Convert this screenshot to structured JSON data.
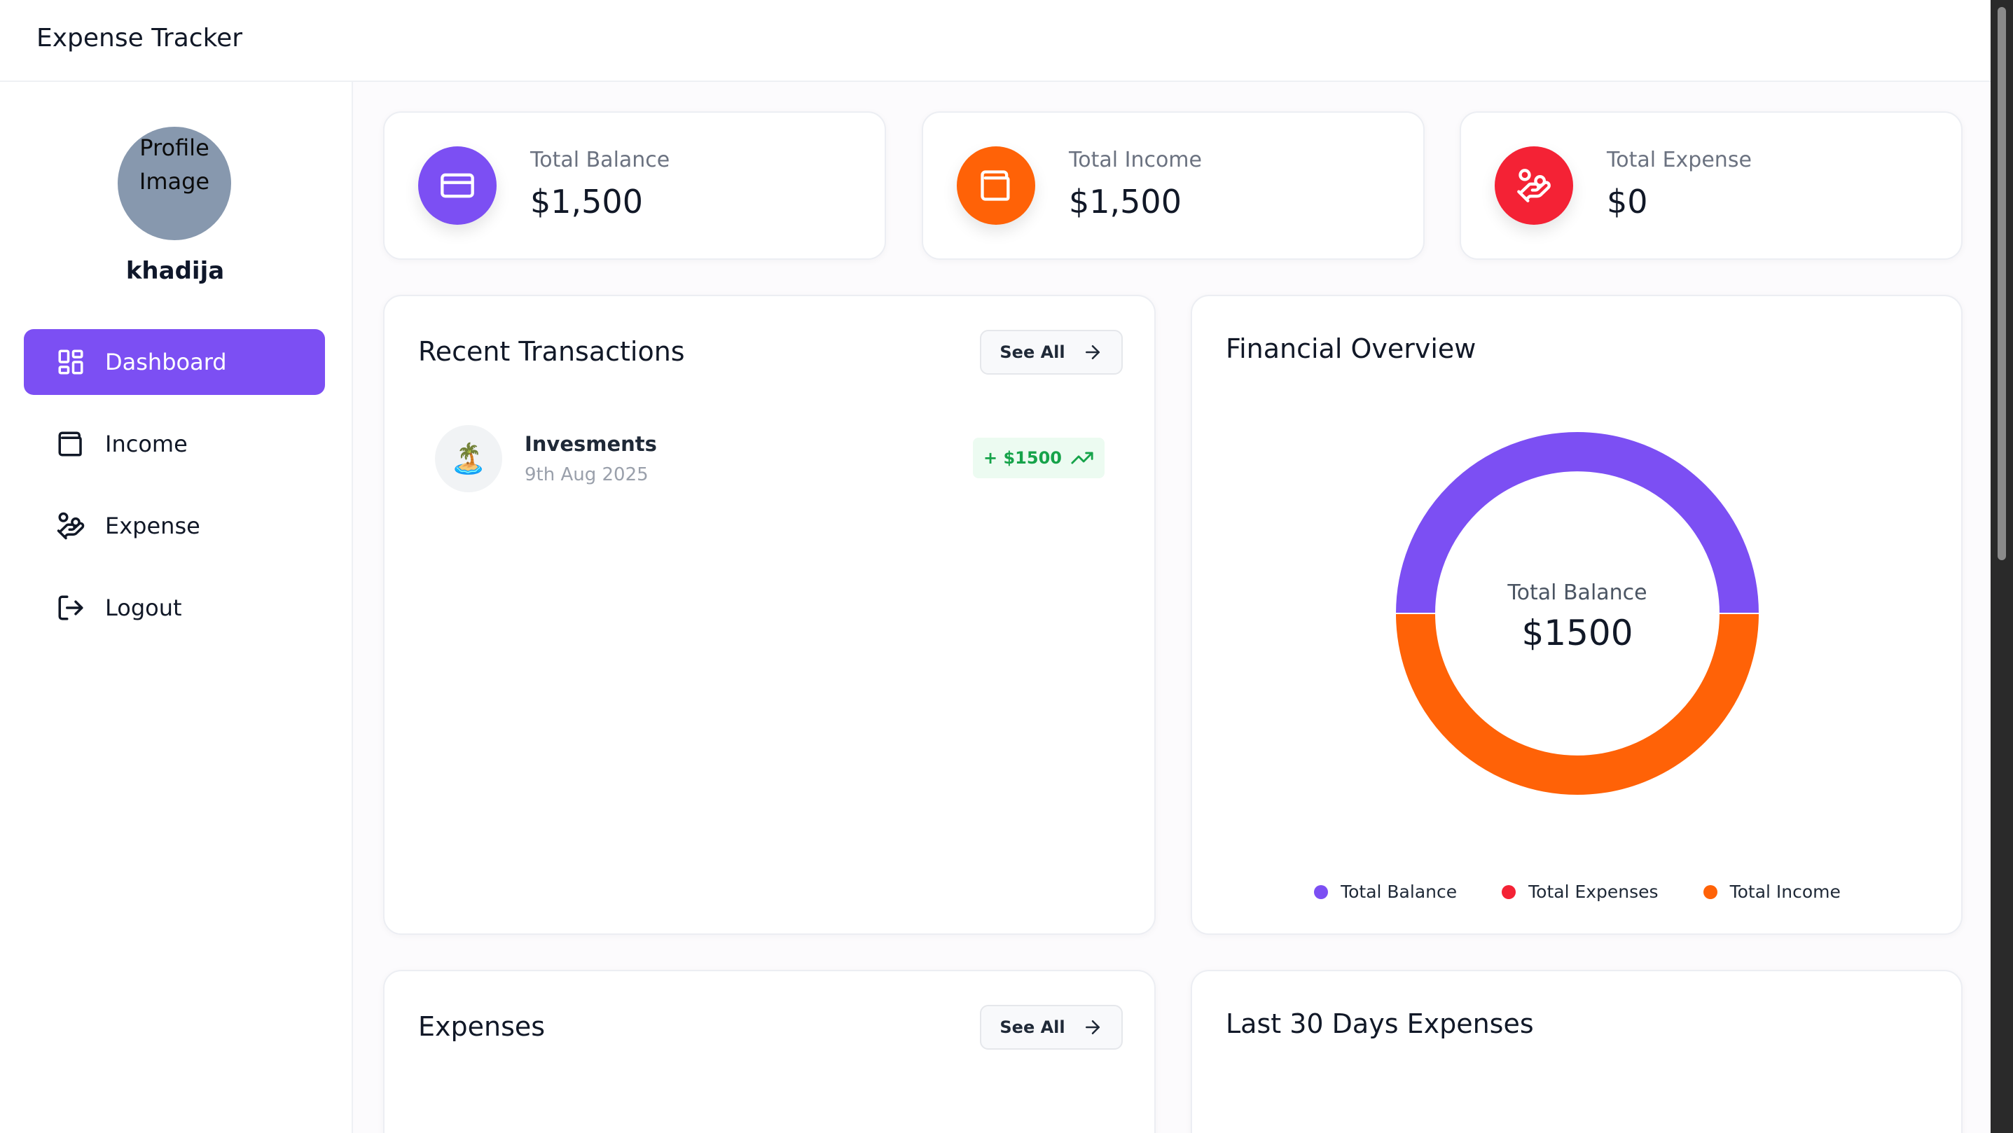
{
  "app": {
    "title": "Expense Tracker"
  },
  "profile": {
    "image_alt": "Profile Image",
    "name": "khadija"
  },
  "nav": [
    {
      "label": "Dashboard",
      "icon": "dashboard-icon",
      "active": true
    },
    {
      "label": "Income",
      "icon": "wallet-icon",
      "active": false
    },
    {
      "label": "Expense",
      "icon": "hand-coins-icon",
      "active": false
    },
    {
      "label": "Logout",
      "icon": "logout-icon",
      "active": false
    }
  ],
  "stats": [
    {
      "label": "Total Balance",
      "value": "$1,500",
      "icon": "credit-card-icon",
      "color": "#7c4ff3"
    },
    {
      "label": "Total Income",
      "value": "$1,500",
      "icon": "wallet-icon",
      "color": "#ff6207"
    },
    {
      "label": "Total Expense",
      "value": "$0",
      "icon": "hand-coins-icon",
      "color": "#f42235"
    }
  ],
  "recent": {
    "title": "Recent Transactions",
    "see_all": "See All",
    "transactions": [
      {
        "name": "Invesments",
        "date": "9th Aug 2025",
        "amount": "+ $1500",
        "emoji": "🏝️",
        "trend": "trending-up-icon"
      }
    ]
  },
  "overview": {
    "title": "Financial Overview",
    "center_label": "Total Balance",
    "center_value": "$1500",
    "chart_data": {
      "type": "pie",
      "series": [
        {
          "name": "Total Balance",
          "value": 1500,
          "color": "#7c4ff3"
        },
        {
          "name": "Total Expenses",
          "value": 0,
          "color": "#f42235"
        },
        {
          "name": "Total Income",
          "value": 1500,
          "color": "#ff6207"
        }
      ]
    }
  },
  "expenses": {
    "title": "Expenses",
    "see_all": "See All"
  },
  "last30": {
    "title": "Last 30 Days Expenses"
  }
}
